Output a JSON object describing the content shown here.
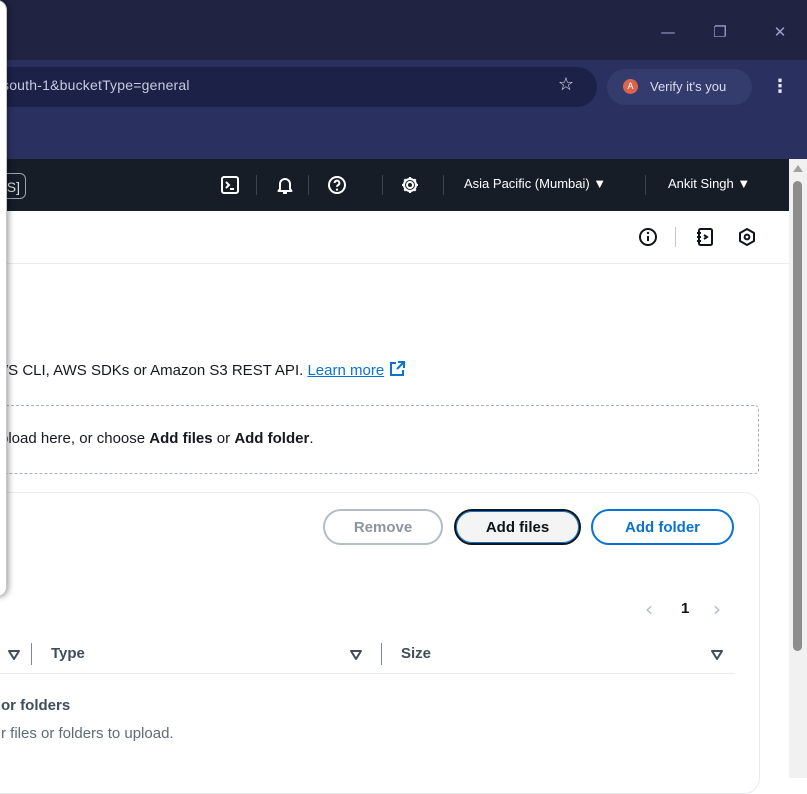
{
  "browser": {
    "url": "south-1&bucketType=general",
    "verify_label": "Verify it's you",
    "profile_initial": "A",
    "window_controls": {
      "minimize": "—",
      "restore": "❐",
      "close": "✕"
    }
  },
  "aws_nav": {
    "search_fragment": "S]",
    "region": "Asia Pacific (Mumbai) ▼",
    "user": "Ankit Singh ▼",
    "icons": [
      "cloudshell-icon",
      "bell-icon",
      "help-icon",
      "gear-icon"
    ]
  },
  "page": {
    "description_text": "WS CLI, AWS SDKs or Amazon S3 REST API.",
    "learn_more": "Learn more",
    "drop_text_prefix": "pload here, or choose ",
    "drop_add_files": "Add files",
    "drop_or": " or ",
    "drop_add_folder": "Add folder",
    "drop_end": "."
  },
  "files_panel": {
    "remove_label": "Remove",
    "add_files_label": "Add files",
    "add_folder_label": "Add folder",
    "pager": {
      "prev": "‹",
      "page": "1",
      "next": "›"
    },
    "columns": [
      {
        "label": "Type"
      },
      {
        "label": "Size"
      }
    ],
    "empty_title": "or folders",
    "empty_sub": "r files or folders to upload."
  }
}
